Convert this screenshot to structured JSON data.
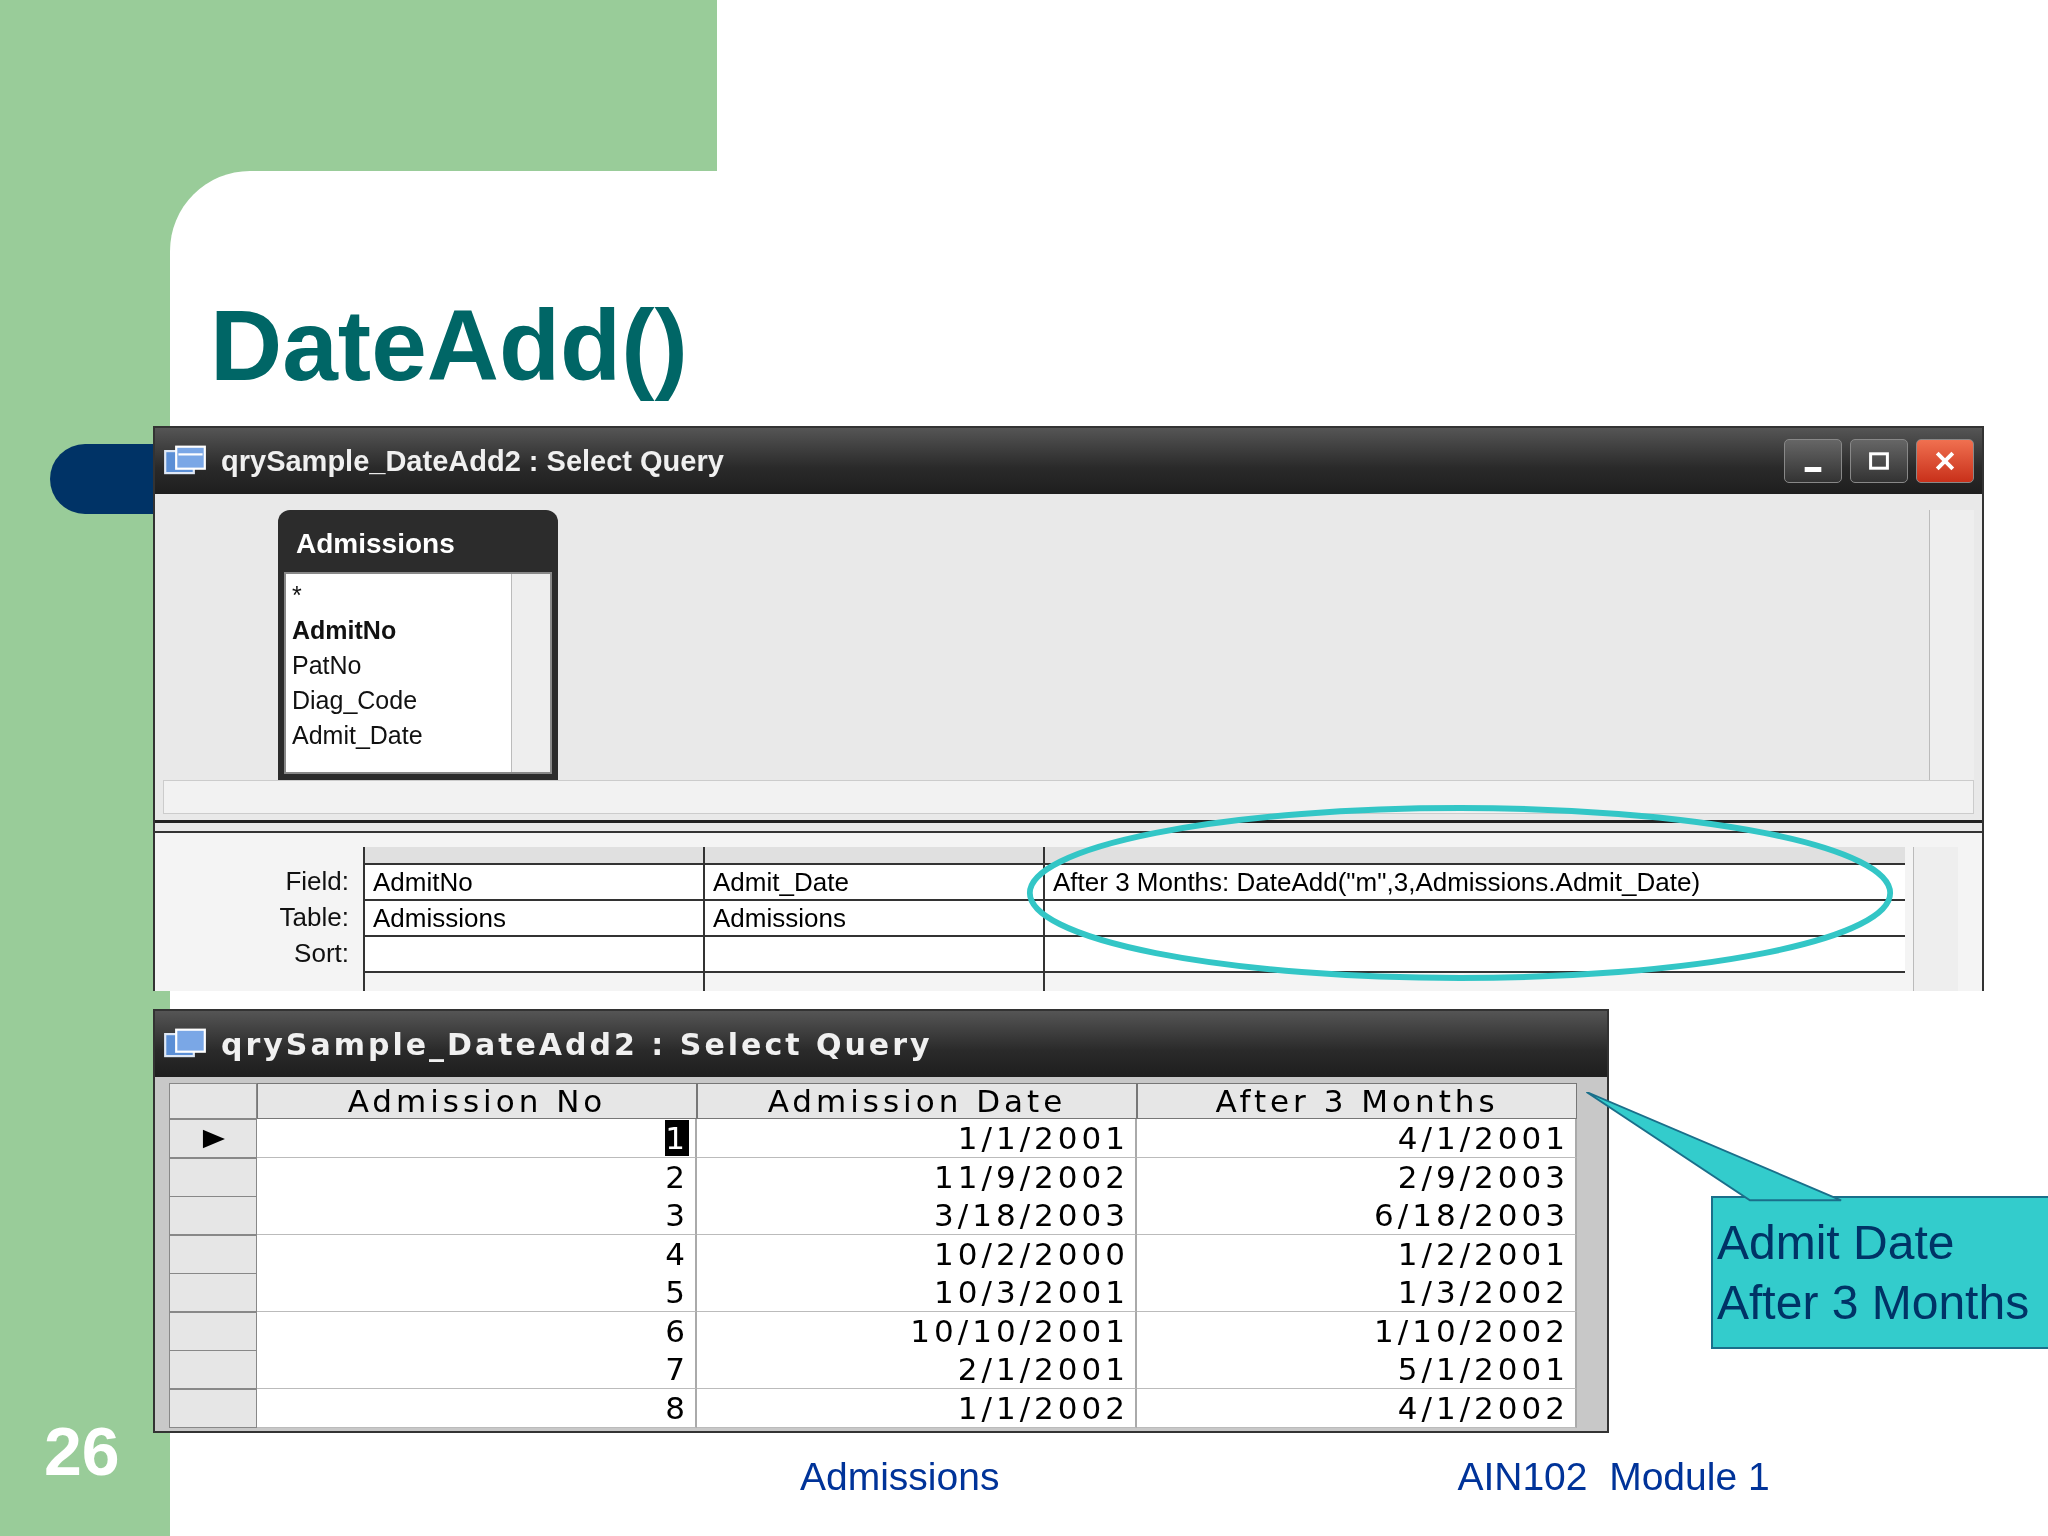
{
  "slide": {
    "title": "DateAdd()",
    "number": "26",
    "footer_center": "Admissions",
    "footer_right": "AIN102  Module 1"
  },
  "design_window": {
    "title": "qrySample_DateAdd2 : Select Query",
    "table_box": {
      "title": "Admissions",
      "fields": [
        {
          "name": "*",
          "primary_key": false
        },
        {
          "name": "AdmitNo",
          "primary_key": true
        },
        {
          "name": "PatNo",
          "primary_key": false
        },
        {
          "name": "Diag_Code",
          "primary_key": false
        },
        {
          "name": "Admit_Date",
          "primary_key": false
        }
      ]
    },
    "grid": {
      "row_labels": [
        "Field:",
        "Table:",
        "Sort:"
      ],
      "columns": [
        {
          "field": "AdmitNo",
          "table": "Admissions",
          "highlighted": false
        },
        {
          "field": "Admit_Date",
          "table": "Admissions",
          "highlighted": false
        },
        {
          "field": "After 3 Months: DateAdd(\"m\",3,Admissions.Admit_Date)",
          "highlighted": true
        }
      ]
    }
  },
  "datasheet_window": {
    "title": "qrySample_DateAdd2 : Select Query",
    "columns": [
      "Admission No",
      "Admission Date",
      "After 3 Months"
    ],
    "rows": [
      {
        "cells": [
          "1",
          "1/1/2001",
          "4/1/2001"
        ],
        "current": true
      },
      {
        "cells": [
          "2",
          "11/9/2002",
          "2/9/2003"
        ],
        "current": false
      },
      {
        "cells": [
          "3",
          "3/18/2003",
          "6/18/2003"
        ],
        "current": false
      },
      {
        "cells": [
          "4",
          "10/2/2000",
          "1/2/2001"
        ],
        "current": false
      },
      {
        "cells": [
          "5",
          "10/3/2001",
          "1/3/2002"
        ],
        "current": false
      },
      {
        "cells": [
          "6",
          "10/10/2001",
          "1/10/2002"
        ],
        "current": false
      },
      {
        "cells": [
          "7",
          "2/1/2001",
          "5/1/2001"
        ],
        "current": false
      },
      {
        "cells": [
          "8",
          "1/1/2002",
          "4/1/2002"
        ],
        "current": false
      }
    ]
  },
  "callout": {
    "lines": [
      "Admit Date",
      "After 3 Months"
    ]
  }
}
